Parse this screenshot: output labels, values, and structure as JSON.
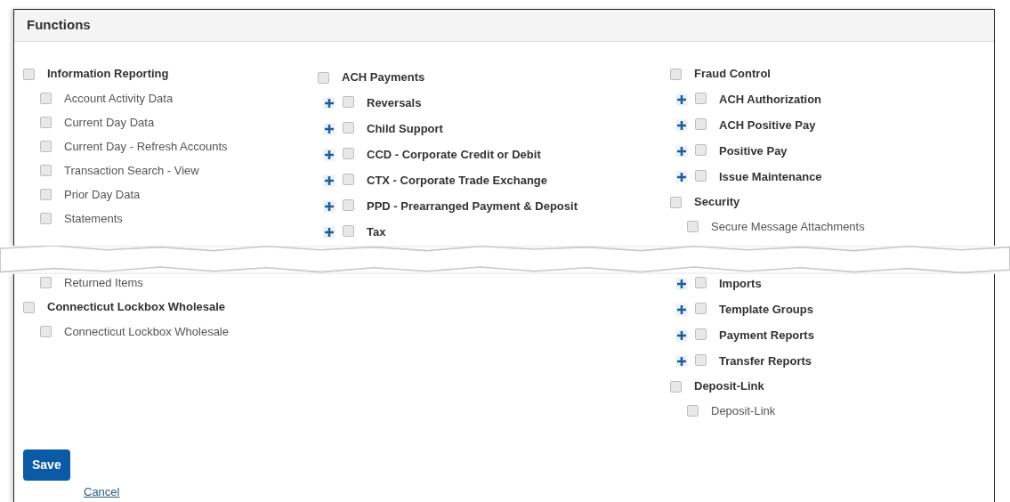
{
  "title": "Functions",
  "top": {
    "columns": [
      [
        {
          "kind": "group",
          "label": "Information Reporting",
          "checked": false
        },
        {
          "kind": "item",
          "label": "Account Activity Data",
          "checked": false
        },
        {
          "kind": "item",
          "label": "Current Day Data",
          "checked": false
        },
        {
          "kind": "item",
          "label": "Current Day - Refresh Accounts",
          "checked": false
        },
        {
          "kind": "item",
          "label": "Transaction Search - View",
          "checked": false
        },
        {
          "kind": "item",
          "label": "Prior Day Data",
          "checked": false
        },
        {
          "kind": "item",
          "label": "Statements",
          "checked": false
        }
      ],
      [
        {
          "kind": "group",
          "label": "ACH Payments",
          "checked": false
        },
        {
          "kind": "expandable",
          "label": "Reversals",
          "checked": false,
          "expanded": false
        },
        {
          "kind": "expandable",
          "label": "Child Support",
          "checked": false,
          "expanded": false
        },
        {
          "kind": "expandable",
          "label": "CCD - Corporate Credit or Debit",
          "checked": false,
          "expanded": false
        },
        {
          "kind": "expandable",
          "label": "CTX - Corporate Trade Exchange",
          "checked": false,
          "expanded": false
        },
        {
          "kind": "expandable",
          "label": "PPD - Prearranged Payment & Deposit",
          "checked": false,
          "expanded": false
        },
        {
          "kind": "expandable",
          "label": "Tax",
          "checked": false,
          "expanded": false
        }
      ],
      [
        {
          "kind": "group",
          "label": "Fraud Control",
          "checked": false
        },
        {
          "kind": "expandable",
          "label": "ACH Authorization",
          "checked": false,
          "expanded": false
        },
        {
          "kind": "expandable",
          "label": "ACH Positive Pay",
          "checked": false,
          "expanded": false
        },
        {
          "kind": "expandable",
          "label": "Positive Pay",
          "checked": false,
          "expanded": false
        },
        {
          "kind": "expandable",
          "label": "Issue Maintenance",
          "checked": false,
          "expanded": false
        },
        {
          "kind": "group",
          "label": "Security",
          "checked": false
        },
        {
          "kind": "item",
          "label": "Secure Message Attachments",
          "checked": false
        }
      ]
    ]
  },
  "bottom": {
    "columns": [
      [
        {
          "kind": "item",
          "label": "Returned Items",
          "checked": false
        },
        {
          "kind": "group",
          "label": "Connecticut Lockbox Wholesale",
          "checked": false
        },
        {
          "kind": "item",
          "label": "Connecticut Lockbox Wholesale",
          "checked": false
        }
      ],
      [],
      [
        {
          "kind": "expandable",
          "label": "Imports",
          "checked": false,
          "expanded": false
        },
        {
          "kind": "expandable",
          "label": "Template Groups",
          "checked": false,
          "expanded": false
        },
        {
          "kind": "expandable",
          "label": "Payment Reports",
          "checked": false,
          "expanded": false
        },
        {
          "kind": "expandable",
          "label": "Transfer Reports",
          "checked": false,
          "expanded": false
        },
        {
          "kind": "group",
          "label": "Deposit-Link",
          "checked": false
        },
        {
          "kind": "item",
          "label": "Deposit-Link",
          "checked": false
        }
      ]
    ]
  },
  "buttons": {
    "save": "Save",
    "cancel": "Cancel"
  }
}
